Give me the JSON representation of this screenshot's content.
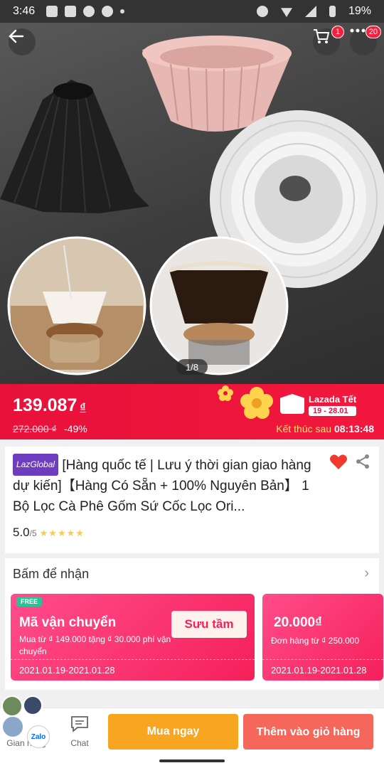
{
  "status_bar": {
    "time": "3:46",
    "battery": "19%"
  },
  "gallery": {
    "counter": "1/8",
    "cart_count": "1",
    "more_count": "20"
  },
  "price": {
    "current": "139.087",
    "currency": "₫",
    "original": "272.000 ₫",
    "discount": "-49%",
    "campaign_brand": "Lazada Tết",
    "campaign_dates": "19 - 28.01",
    "ends_label": "Kết thúc sau",
    "countdown": "08:13:48"
  },
  "product": {
    "badge": "LazGlobal",
    "title": "[Hàng quốc tế | Lưu ý thời gian giao hàng dự kiến]【Hàng Có Sẵn + 100% Nguyên Bản】 1 Bộ Lọc Cà Phê Gốm Sứ Cốc Lọc Ori...",
    "rating": "5.0",
    "rating_max": "/5",
    "stars": "★★★★★"
  },
  "vouchers": {
    "heading": "Bấm để nhận",
    "items": [
      {
        "tag": "FREE",
        "title": "Mã vận chuyển",
        "desc": "Mua từ ₫ 149.000 tặng ₫ 30.000 phí vận chuyển",
        "date": "2021.01.19-2021.01.28",
        "action": "Sưu tầm"
      },
      {
        "title": "20.000₫",
        "desc": "Đơn hàng từ ₫ 250.000",
        "date": "2021.01.19-2021.01.28"
      }
    ]
  },
  "bottom_bar": {
    "store_label": "Gian hàng",
    "chat_label": "Chat",
    "buy_now": "Mua ngay",
    "add_to_cart": "Thêm vào giỏ hàng",
    "zalo_label": "Zalo"
  },
  "colors": {
    "accent_red": "#f2183d",
    "buy_orange": "#f8a51f",
    "cart_coral": "#f4675a",
    "voucher_pink": "#f5205a"
  }
}
